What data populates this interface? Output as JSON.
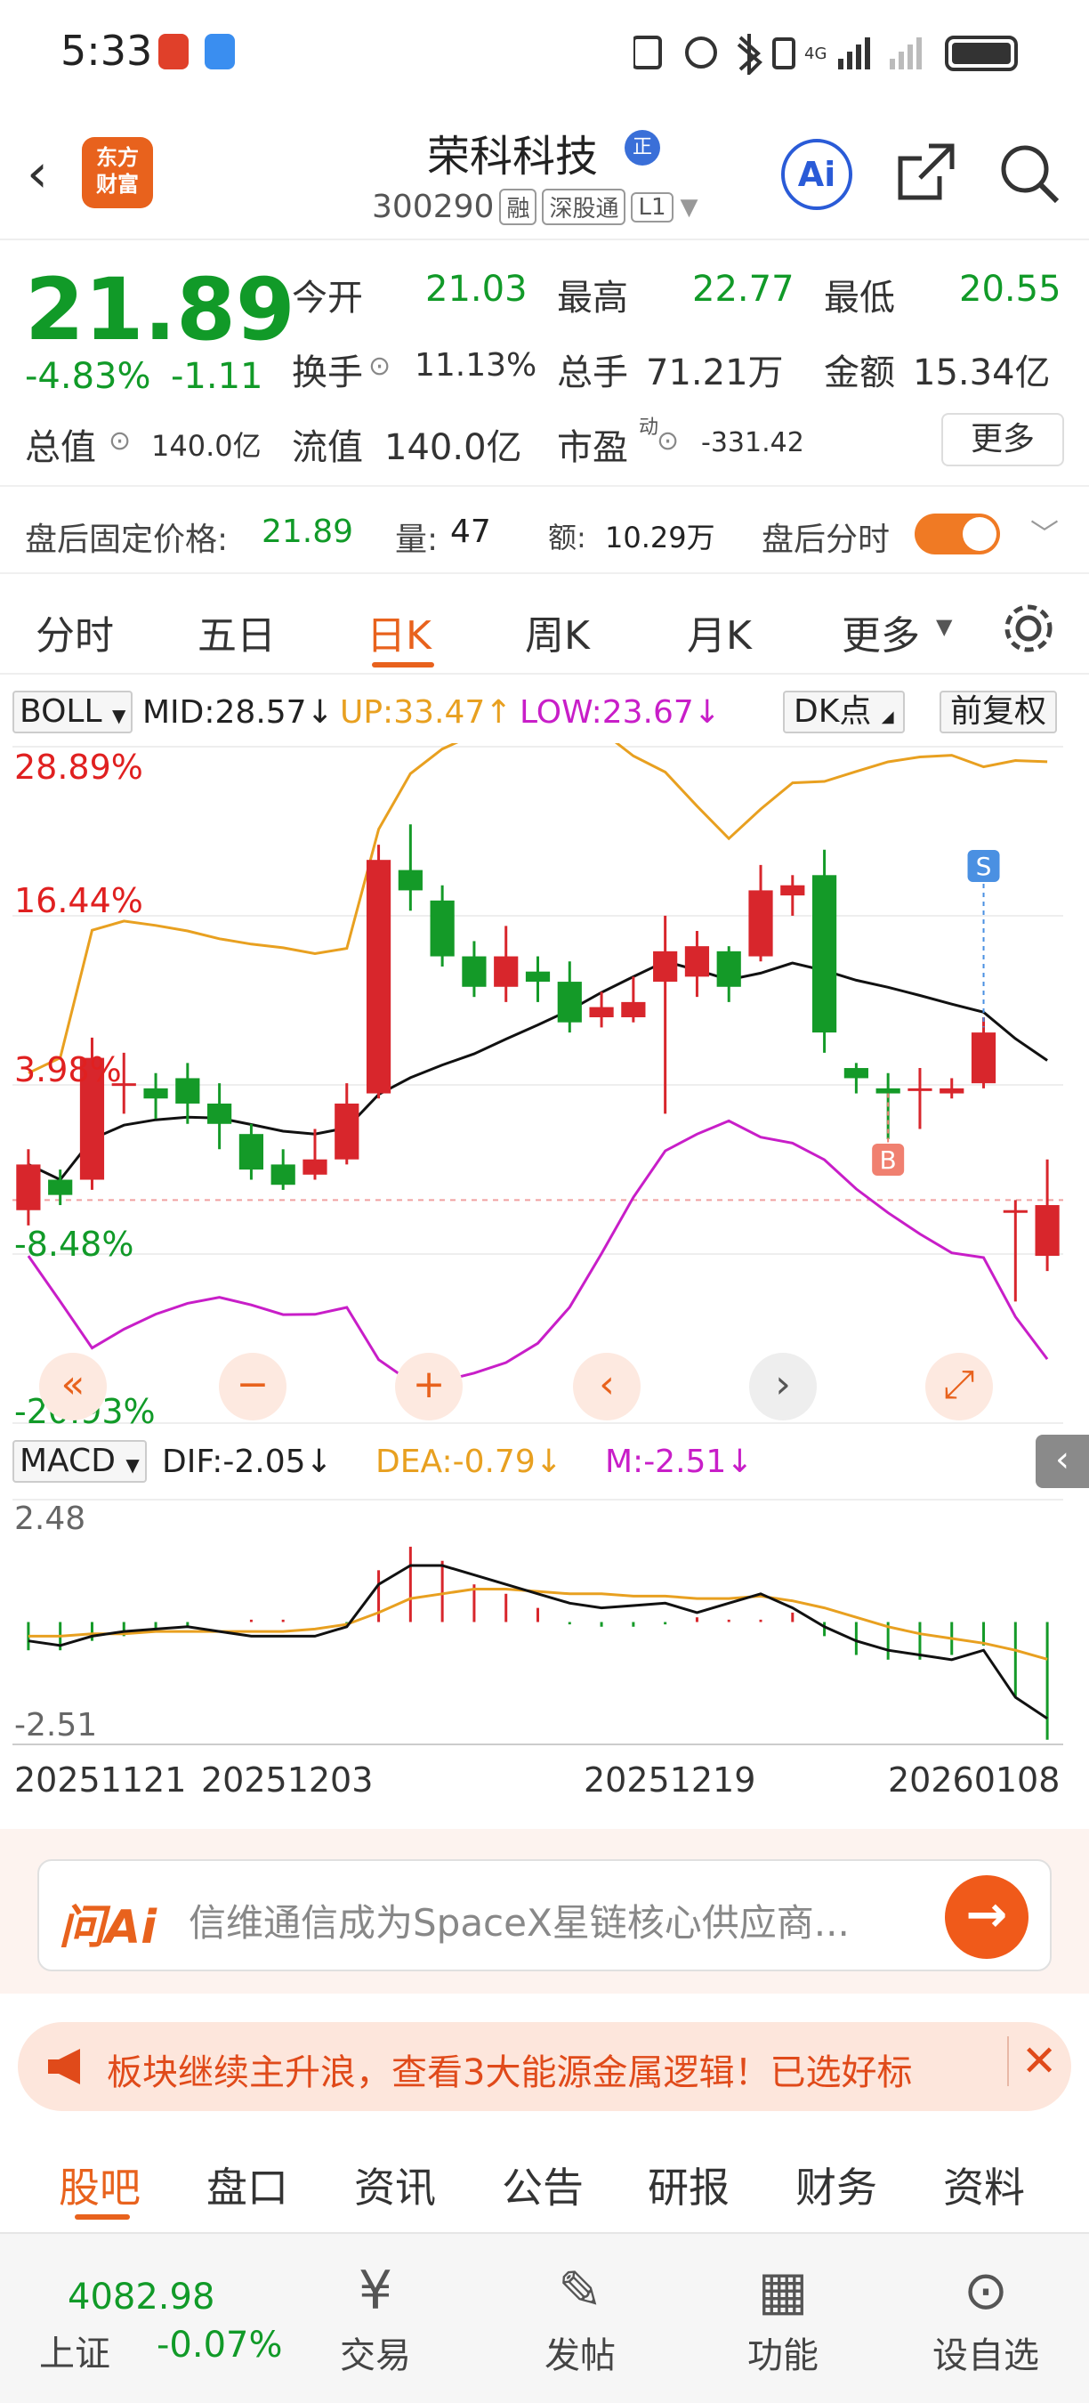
{
  "status_bar": {
    "time": "5:33",
    "network_label": "4G"
  },
  "header": {
    "stock_name": "荣科科技",
    "zheng_badge": "正",
    "stock_code": "300290",
    "tags": [
      "融",
      "深股通",
      "L1"
    ],
    "logo_line1": "东方",
    "logo_line2": "财富",
    "ai_label": "Ai"
  },
  "quote": {
    "price": "21.89",
    "change_pct": "-4.83%",
    "change_amt": "-1.11",
    "open_label": "今开",
    "open_val": "21.03",
    "high_label": "最高",
    "high_val": "22.77",
    "low_label": "最低",
    "low_val": "20.55",
    "turnover_label": "换手",
    "turnover_val": "11.13%",
    "volume_label": "总手",
    "volume_val": "71.21万",
    "amount_label": "金额",
    "amount_val": "15.34亿",
    "mcap_label": "总值",
    "mcap_val": "140.0亿",
    "float_label": "流值",
    "float_val": "140.0亿",
    "pe_label": "市盈",
    "pe_sup": "动",
    "pe_val": "-331.42",
    "more_label": "更多"
  },
  "after_hours": {
    "price_label": "盘后固定价格:",
    "price_val": "21.89",
    "vol_label": "量:",
    "vol_val": "47",
    "amt_label": "额:",
    "amt_val": "10.29万",
    "toggle_label": "盘后分时",
    "toggle_on": true
  },
  "kline_tabs": [
    "分时",
    "五日",
    "日K",
    "周K",
    "月K",
    "更多"
  ],
  "active_tab": "日K",
  "boll": {
    "name": "BOLL",
    "mid": "MID:28.57↓",
    "up": "UP:33.47↑",
    "low": "LOW:23.67↓",
    "dk_label": "DK点",
    "fq_label": "前复权"
  },
  "macd": {
    "name": "MACD",
    "dif": "DIF:-2.05↓",
    "dea": "DEA:-0.79↓",
    "m": "M:-2.51↓",
    "axis_top": "2.48",
    "axis_bottom": "-2.51"
  },
  "colors": {
    "up": "#d8262c",
    "down": "#149a28",
    "accent": "#e8621d",
    "boll_up": "#e8a020",
    "boll_low": "#c81ec8",
    "boll_mid": "#111111"
  },
  "chart_data": {
    "type": "candlestick",
    "y_axis_labels": [
      "28.89%",
      "16.44%",
      "3.98%",
      "-8.48%",
      "-20.93%"
    ],
    "x_axis_labels": [
      "20251121",
      "20251203",
      "20251219",
      "20260108"
    ],
    "markers": [
      {
        "label": "S"
      },
      {
        "label": "B"
      }
    ],
    "candles": [
      {
        "o": 21.8,
        "c": 22.7,
        "h": 23.0,
        "l": 21.5
      },
      {
        "o": 22.4,
        "c": 22.1,
        "h": 22.6,
        "l": 21.9
      },
      {
        "o": 22.4,
        "c": 24.8,
        "h": 25.2,
        "l": 22.2
      },
      {
        "o": 24.3,
        "c": 24.3,
        "h": 24.9,
        "l": 23.7
      },
      {
        "o": 24.2,
        "c": 24.0,
        "h": 24.5,
        "l": 23.6
      },
      {
        "o": 24.4,
        "c": 23.9,
        "h": 24.7,
        "l": 23.5
      },
      {
        "o": 23.9,
        "c": 23.5,
        "h": 24.3,
        "l": 23.0
      },
      {
        "o": 23.3,
        "c": 22.6,
        "h": 23.5,
        "l": 22.4
      },
      {
        "o": 22.7,
        "c": 22.3,
        "h": 23.0,
        "l": 22.2
      },
      {
        "o": 22.5,
        "c": 22.8,
        "h": 23.4,
        "l": 22.4
      },
      {
        "o": 22.8,
        "c": 23.9,
        "h": 24.3,
        "l": 22.7
      },
      {
        "o": 24.1,
        "c": 28.7,
        "h": 29.0,
        "l": 24.0
      },
      {
        "o": 28.5,
        "c": 28.1,
        "h": 29.4,
        "l": 27.7
      },
      {
        "o": 27.9,
        "c": 26.8,
        "h": 28.2,
        "l": 26.6
      },
      {
        "o": 26.8,
        "c": 26.2,
        "h": 27.1,
        "l": 26.0
      },
      {
        "o": 26.2,
        "c": 26.8,
        "h": 27.4,
        "l": 25.9
      },
      {
        "o": 26.5,
        "c": 26.3,
        "h": 26.8,
        "l": 25.9
      },
      {
        "o": 26.3,
        "c": 25.5,
        "h": 26.7,
        "l": 25.3
      },
      {
        "o": 25.6,
        "c": 25.8,
        "h": 26.1,
        "l": 25.4
      },
      {
        "o": 25.6,
        "c": 25.9,
        "h": 26.4,
        "l": 25.5
      },
      {
        "o": 26.3,
        "c": 26.9,
        "h": 27.6,
        "l": 23.7
      },
      {
        "o": 26.4,
        "c": 27.0,
        "h": 27.3,
        "l": 26.0
      },
      {
        "o": 26.9,
        "c": 26.2,
        "h": 27.0,
        "l": 25.9
      },
      {
        "o": 26.8,
        "c": 28.1,
        "h": 28.6,
        "l": 26.7
      },
      {
        "o": 28.0,
        "c": 28.2,
        "h": 28.4,
        "l": 27.6
      },
      {
        "o": 28.4,
        "c": 25.3,
        "h": 28.9,
        "l": 24.9
      },
      {
        "o": 24.6,
        "c": 24.4,
        "h": 24.7,
        "l": 24.1
      },
      {
        "o": 24.2,
        "c": 24.1,
        "h": 24.5,
        "l": 23.2
      },
      {
        "o": 24.2,
        "c": 24.2,
        "h": 24.6,
        "l": 23.4
      },
      {
        "o": 24.1,
        "c": 24.2,
        "h": 24.4,
        "l": 24.0
      },
      {
        "o": 24.3,
        "c": 25.3,
        "h": 25.6,
        "l": 24.2
      },
      {
        "o": 21.8,
        "c": 21.8,
        "h": 22.0,
        "l": 20.0
      },
      {
        "o": 20.9,
        "c": 21.9,
        "h": 22.8,
        "l": 20.6
      }
    ],
    "macd_hist": [
      -0.6,
      -0.6,
      -0.4,
      -0.3,
      -0.2,
      -0.1,
      0,
      0.05,
      0.05,
      0.0,
      -0.1,
      1.1,
      1.6,
      1.3,
      0.8,
      0.6,
      0.3,
      -0.05,
      -0.1,
      -0.1,
      -0.05,
      0.1,
      0.05,
      0.05,
      0.2,
      -0.3,
      -0.7,
      -0.8,
      -0.8,
      -0.7,
      -0.5,
      -1.6,
      -2.5
    ],
    "dif": [
      -0.4,
      -0.5,
      -0.3,
      -0.2,
      -0.15,
      -0.1,
      -0.2,
      -0.3,
      -0.3,
      -0.3,
      -0.1,
      0.8,
      1.2,
      1.2,
      1.0,
      0.8,
      0.6,
      0.4,
      0.3,
      0.35,
      0.4,
      0.2,
      0.4,
      0.6,
      0.3,
      -0.1,
      -0.4,
      -0.6,
      -0.7,
      -0.8,
      -0.6,
      -1.6,
      -2.05
    ],
    "dea": [
      -0.3,
      -0.3,
      -0.25,
      -0.25,
      -0.2,
      -0.2,
      -0.2,
      -0.2,
      -0.2,
      -0.15,
      -0.05,
      0.2,
      0.5,
      0.6,
      0.7,
      0.7,
      0.65,
      0.6,
      0.6,
      0.55,
      0.55,
      0.5,
      0.5,
      0.55,
      0.45,
      0.3,
      0.1,
      -0.1,
      -0.25,
      -0.35,
      -0.45,
      -0.6,
      -0.79
    ]
  },
  "ai_bar": {
    "logo": "问Ai",
    "text": "信维通信成为SpaceX星链核心供应商...",
    "go": "→"
  },
  "banner": {
    "text": "板块继续主升浪，查看3大能源金属逻辑！已选好标",
    "close": "✕"
  },
  "bottom_tabs": [
    "股吧",
    "盘口",
    "资讯",
    "公告",
    "研报",
    "财务",
    "资料"
  ],
  "nav": {
    "index_value": "4082.98",
    "index_name": "上证",
    "index_change": "-0.07%",
    "items": [
      "交易",
      "发帖",
      "功能",
      "设自选"
    ]
  }
}
